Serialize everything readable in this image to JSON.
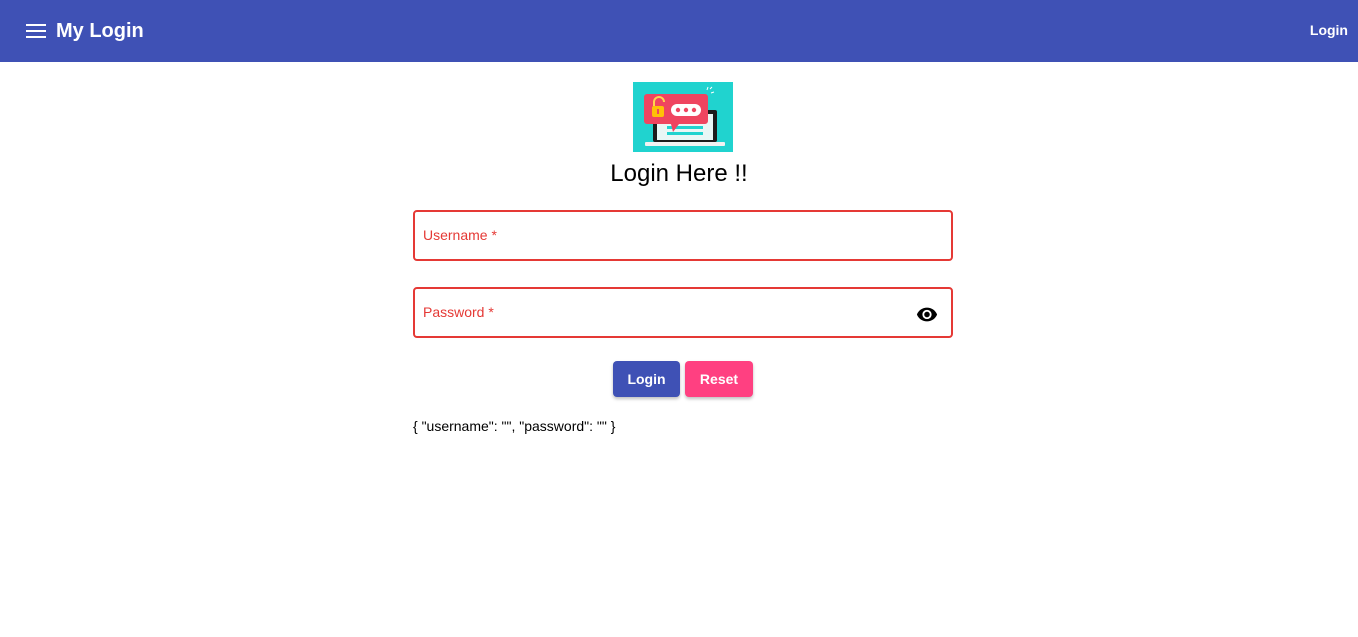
{
  "toolbar": {
    "menu_icon": "hamburger-menu-icon",
    "title": "My Login",
    "login_link": "Login",
    "color": "#3f51b5"
  },
  "main": {
    "logo_icon": "unlock-password-laptop-illustration",
    "heading": "Login Here !!",
    "username": {
      "placeholder": "Username *",
      "value": ""
    },
    "password": {
      "placeholder": "Password *",
      "value": "",
      "toggle_icon": "eye-icon"
    },
    "buttons": {
      "login_label": "Login",
      "reset_label": "Reset",
      "login_color": "#3f51b5",
      "reset_color": "#ff4081"
    },
    "form_json": "{ \"username\": \"\", \"password\": \"\" }",
    "error_color": "#e53935"
  }
}
